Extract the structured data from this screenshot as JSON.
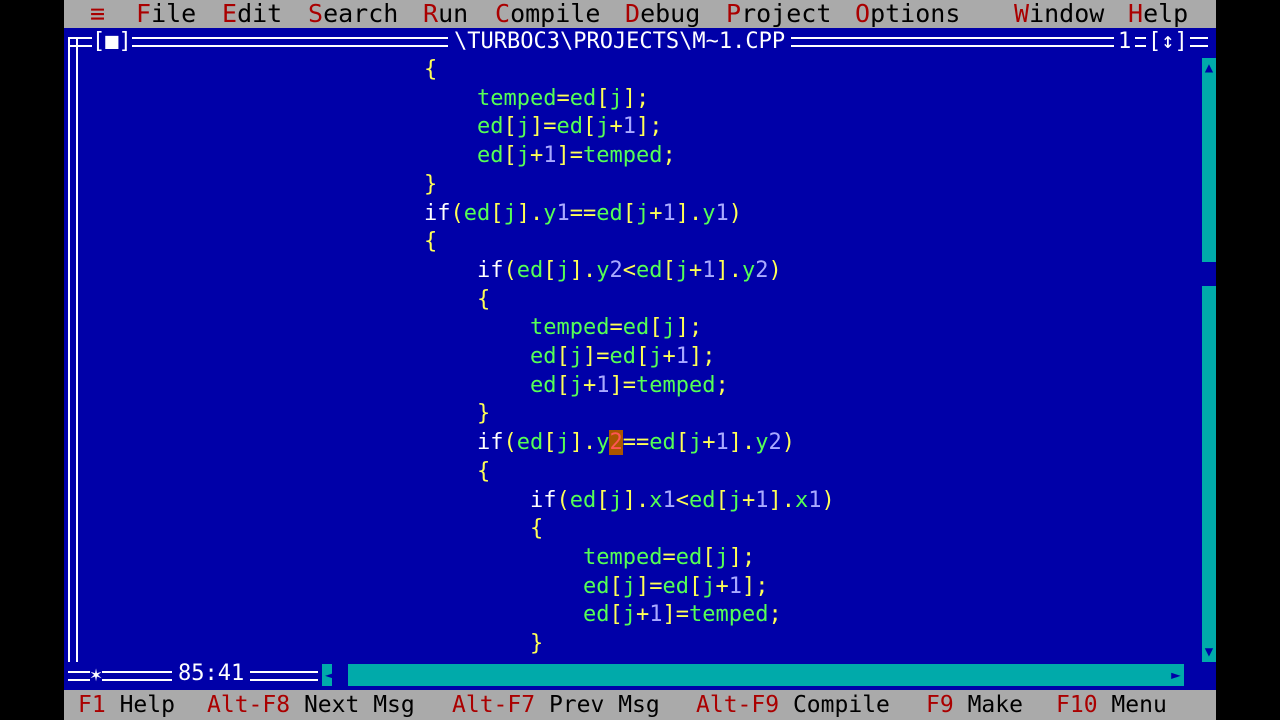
{
  "menu": {
    "system": "≡",
    "items": [
      {
        "hot": "F",
        "rest": "ile"
      },
      {
        "hot": "E",
        "rest": "dit"
      },
      {
        "hot": "S",
        "rest": "earch"
      },
      {
        "hot": "R",
        "rest": "un"
      },
      {
        "hot": "C",
        "rest": "ompile"
      },
      {
        "hot": "D",
        "rest": "ebug"
      },
      {
        "hot": "P",
        "rest": "roject"
      },
      {
        "hot": "O",
        "rest": "ptions"
      },
      {
        "hot": "W",
        "rest": "indow"
      },
      {
        "hot": "H",
        "rest": "elp"
      }
    ]
  },
  "window": {
    "close_box": "[■]",
    "title": "\\TURBOC3\\PROJECTS\\M~1.CPP",
    "number": "1",
    "zoom_box": "[↕]"
  },
  "editor": {
    "cursor_position": "85:41",
    "lines": [
      "{",
      "    temped=ed[j];",
      "    ed[j]=ed[j+1];",
      "    ed[j+1]=temped;",
      "}",
      "if(ed[j].y1==ed[j+1].y1)",
      "{",
      "    if(ed[j].y2<ed[j+1].y2)",
      "    {",
      "        temped=ed[j];",
      "        ed[j]=ed[j+1];",
      "        ed[j+1]=temped;",
      "    }",
      "    if(ed[j].y2==ed[j+1].y2)",
      "    {",
      "        if(ed[j].x1<ed[j+1].x1)",
      "        {",
      "            temped=ed[j];",
      "            ed[j]=ed[j+1];",
      "            ed[j+1]=temped;",
      "        }"
    ]
  },
  "statusbar": [
    {
      "key": "F1",
      "label": "Help"
    },
    {
      "key": "Alt-F8",
      "label": "Next Msg"
    },
    {
      "key": "Alt-F7",
      "label": "Prev Msg"
    },
    {
      "key": "Alt-F9",
      "label": "Compile"
    },
    {
      "key": "F9",
      "label": "Make"
    },
    {
      "key": "F10",
      "label": "Menu"
    }
  ],
  "colors": {
    "background": "#0000a8",
    "menu_bg": "#aaaaaa",
    "hotkey": "#aa0000",
    "code_text": "#ffff55",
    "identifier": "#55ff55",
    "number": "#aaaaff",
    "cursor": "#aa5500"
  }
}
